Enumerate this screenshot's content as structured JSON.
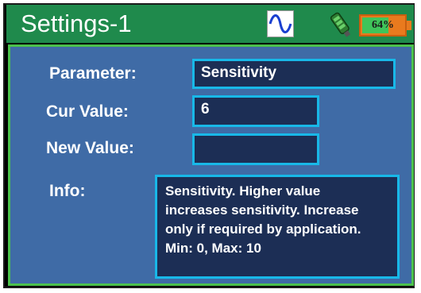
{
  "header": {
    "title": "Settings-1",
    "battery_percent_label": "64%",
    "battery_level": 0.64,
    "icons": [
      "sine-wave-icon",
      "sensor-probe-icon",
      "battery-icon"
    ]
  },
  "form": {
    "parameter_label": "Parameter:",
    "parameter_value": "Sensitivity",
    "cur_value_label": "Cur Value:",
    "cur_value": "6",
    "new_value_label": "New Value:",
    "new_value": "",
    "info_label": "Info:",
    "info_lines": [
      "Sensitivity.  Higher value",
      "increases sensitivity.  Increase",
      "only if required by application.",
      "Min: 0, Max: 10"
    ]
  },
  "colors": {
    "title_bar": "#1f8a4c",
    "panel_bg": "#3f6ba6",
    "field_bg": "#1c2e55",
    "field_border": "#18b8e8",
    "panel_border": "#4cc14c",
    "battery_body": "#e97a1e",
    "battery_fill": "#3fc45a"
  }
}
